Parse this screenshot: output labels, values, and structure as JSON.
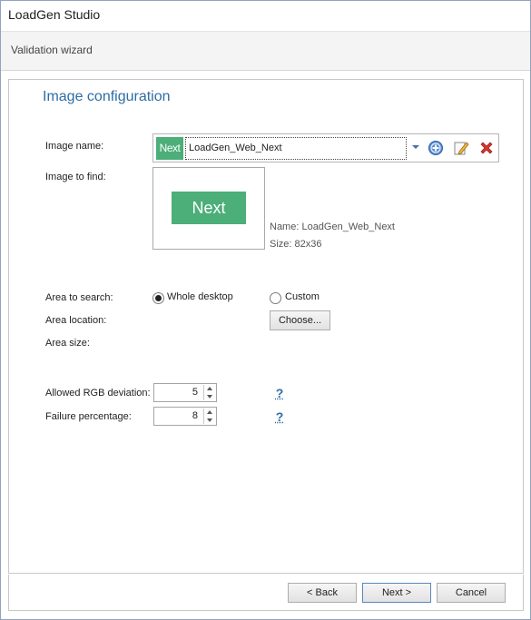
{
  "window": {
    "title": "LoadGen Studio"
  },
  "header": {
    "subtitle": "Validation wizard"
  },
  "section": {
    "title": "Image configuration"
  },
  "image_name": {
    "label": "Image name:",
    "thumb_text": "Next",
    "value": "LoadGen_Web_Next",
    "actions": [
      "add-icon",
      "edit-icon",
      "delete-icon"
    ]
  },
  "image_to_find": {
    "label": "Image to find:",
    "preview_text": "Next",
    "name_line": "Name: LoadGen_Web_Next",
    "size_line": "Size: 82x36"
  },
  "area": {
    "search_label": "Area to search:",
    "option_whole": "Whole desktop",
    "option_custom": "Custom",
    "selected": "Whole desktop",
    "location_label": "Area location:",
    "choose_button": "Choose...",
    "size_label": "Area size:"
  },
  "rgb": {
    "label": "Allowed RGB deviation:",
    "value": "5",
    "help": "?"
  },
  "failure": {
    "label": "Failure percentage:",
    "value": "8",
    "help": "?"
  },
  "footer": {
    "back": "< Back",
    "next": "Next >",
    "cancel": "Cancel"
  },
  "colors": {
    "accent": "#2e6da4",
    "brand_green": "#4cae78",
    "delete_red": "#d9342b"
  }
}
